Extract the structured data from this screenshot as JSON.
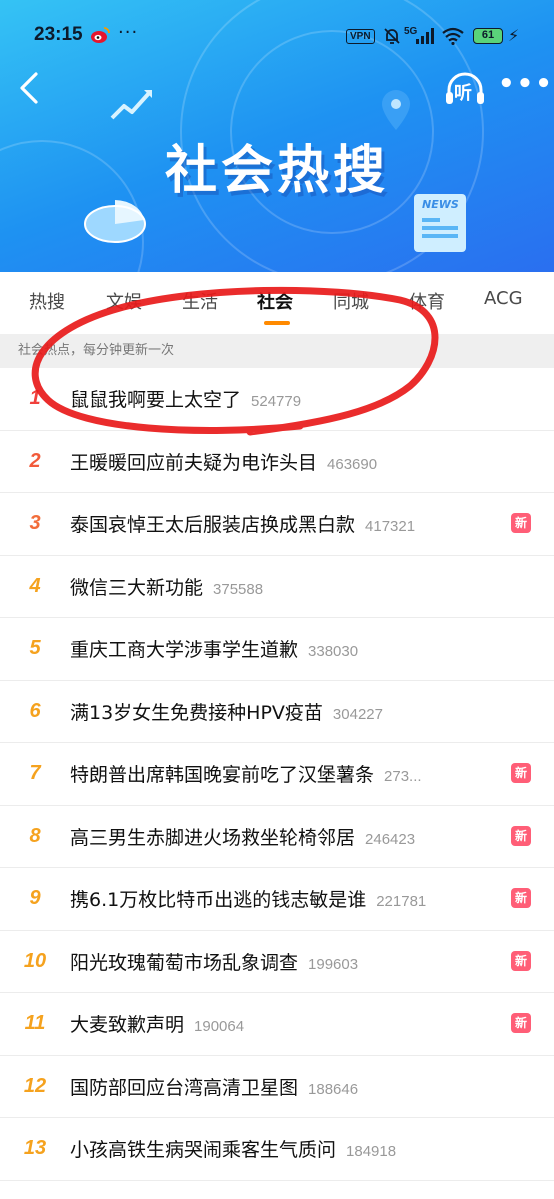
{
  "status_bar": {
    "time": "23:15",
    "more": "···",
    "vpn": "VPN",
    "network": "5G",
    "battery": "61"
  },
  "header": {
    "banner_title": "社会热搜",
    "listen_label": "听",
    "more": "•••",
    "news_label": "NEWS"
  },
  "tabs": [
    {
      "label": "热搜",
      "active": false
    },
    {
      "label": "文娱",
      "active": false
    },
    {
      "label": "生活",
      "active": false
    },
    {
      "label": "社会",
      "active": true
    },
    {
      "label": "同城",
      "active": false
    },
    {
      "label": "体育",
      "active": false
    },
    {
      "label": "ACG",
      "active": false
    }
  ],
  "notice": "社会热点，每分钟更新一次",
  "items": [
    {
      "rank": "1",
      "title": "鼠鼠我啊要上太空了",
      "count": "524779",
      "badge": "",
      "rank_color": "#f0403c"
    },
    {
      "rank": "2",
      "title": "王暖暖回应前夫疑为电诈头目",
      "count": "463690",
      "badge": "",
      "rank_color": "#f25a3a"
    },
    {
      "rank": "3",
      "title": "泰国哀悼王太后服装店换成黑白款",
      "count": "417321",
      "badge": "新",
      "rank_color": "#f26d3a"
    },
    {
      "rank": "4",
      "title": "微信三大新功能",
      "count": "375588",
      "badge": "",
      "rank_color": "#f5a21e"
    },
    {
      "rank": "5",
      "title": "重庆工商大学涉事学生道歉",
      "count": "338030",
      "badge": "",
      "rank_color": "#f5a21e"
    },
    {
      "rank": "6",
      "title": "满13岁女生免费接种HPV疫苗",
      "count": "304227",
      "badge": "",
      "rank_color": "#f5a21e"
    },
    {
      "rank": "7",
      "title": "特朗普出席韩国晚宴前吃了汉堡薯条",
      "count": "273...",
      "badge": "新",
      "rank_color": "#f5a21e"
    },
    {
      "rank": "8",
      "title": "高三男生赤脚进火场救坐轮椅邻居",
      "count": "246423",
      "badge": "新",
      "rank_color": "#f5a21e"
    },
    {
      "rank": "9",
      "title": "携6.1万枚比特币出逃的钱志敏是谁",
      "count": "221781",
      "badge": "新",
      "rank_color": "#f5a21e"
    },
    {
      "rank": "10",
      "title": "阳光玫瑰葡萄市场乱象调查",
      "count": "199603",
      "badge": "新",
      "rank_color": "#f5a21e"
    },
    {
      "rank": "11",
      "title": "大麦致歉声明",
      "count": "190064",
      "badge": "新",
      "rank_color": "#f5a21e"
    },
    {
      "rank": "12",
      "title": "国防部回应台湾高清卫星图",
      "count": "188646",
      "badge": "",
      "rank_color": "#f5a21e"
    },
    {
      "rank": "13",
      "title": "小孩高铁生病哭闹乘客生气质问",
      "count": "184918",
      "badge": "",
      "rank_color": "#f5a21e"
    }
  ],
  "colors": {
    "accent": "#ff8a00",
    "badge": "#ff5e77",
    "annotation": "#e81a1a"
  }
}
